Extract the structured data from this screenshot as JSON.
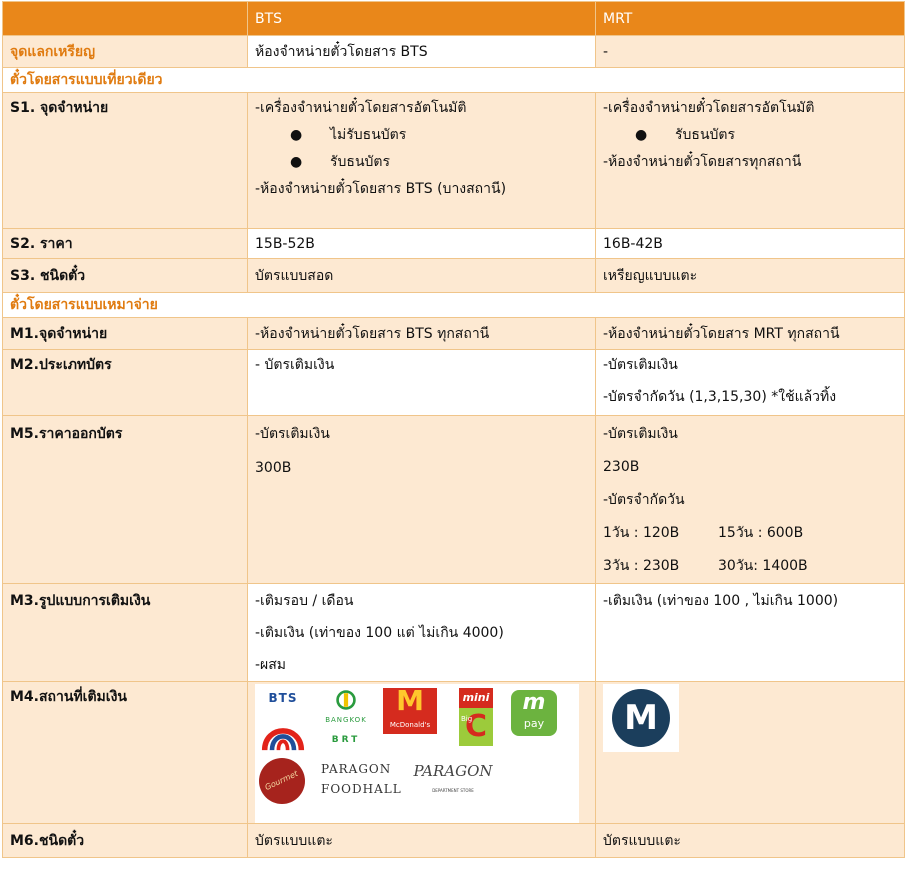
{
  "header": {
    "col1": "",
    "col2": "BTS",
    "col3": "MRT"
  },
  "coin_exchange": {
    "label": "จุดแลกเหรียญ",
    "bts": "ห้องจำหน่ายตั๋วโดยสาร BTS",
    "mrt": "-"
  },
  "section_single": {
    "title": "ตั๋วโดยสารแบบเที่ยวเดียว"
  },
  "s1": {
    "label": "S1. จุดจำหน่าย",
    "bts_line1": "-เครื่องจำหน่ายตั๋วโดยสารอัตโนมัติ",
    "bts_bullets": [
      "ไม่รับธนบัตร",
      "รับธนบัตร"
    ],
    "bts_line2": "-ห้องจำหน่ายตั๋วโดยสาร BTS (บางสถานี)",
    "mrt_line1": "-เครื่องจำหน่ายตั๋วโดยสารอัตโนมัติ",
    "mrt_bullets": [
      "รับธนบัตร"
    ],
    "mrt_line2": "-ห้องจำหน่ายตั๋วโดยสารทุกสถานี"
  },
  "s2": {
    "label": "S2. ราคา",
    "bts": "15B-52B",
    "mrt": "16B-42B"
  },
  "s3": {
    "label": "S3. ชนิดตั๋ว",
    "bts": "บัตรแบบสอด",
    "mrt": "เหรียญแบบแตะ"
  },
  "section_pass": {
    "title": "ตั๋วโดยสารแบบเหมาจ่าย"
  },
  "m1": {
    "label": "M1.จุดจำหน่าย",
    "bts": "-ห้องจำหน่ายตั๋วโดยสาร BTS ทุกสถานี",
    "mrt": "-ห้องจำหน่ายตั๋วโดยสาร MRT ทุกสถานี"
  },
  "m2": {
    "label": "M2.ประเภทบัตร",
    "bts": "- บัตรเติมเงิน",
    "mrt_line1": "-บัตรเติมเงิน",
    "mrt_line2": "-บัตรจำกัดวัน (1,3,15,30) *ใช้แล้วทิ้ง"
  },
  "m5": {
    "label": "M5.ราคาออกบัตร",
    "bts_line1": "-บัตรเติมเงิน",
    "bts_line2": "300B",
    "mrt_line1": "-บัตรเติมเงิน",
    "mrt_line2": "230B",
    "mrt_line3": "-บัตรจำกัดวัน",
    "mrt_r1a": "1วัน : 120B",
    "mrt_r1b": "15วัน : 600B",
    "mrt_r2a": "3วัน : 230B",
    "mrt_r2b": "30วัน: 1400B"
  },
  "m3": {
    "label": "M3.รูปแบบการเติมเงิน",
    "bts_line1": "-เติมรอบ / เดือน",
    "bts_line2": "-เติมเงิน (เท่าของ 100 แต่ ไม่เกิน 4000)",
    "bts_line3": "-ผสม",
    "mrt": "-เติมเงิน (เท่าของ 100 , ไม่เกิน 1000)"
  },
  "m4": {
    "label": "M4.สถานที่เติมเงิน",
    "logos": {
      "bts": "BTS",
      "brt_top": "BANGKOK",
      "brt_bottom": "BRT",
      "mcd": "McDonald's",
      "mini": "mini",
      "bigc": "Big",
      "mpay": "pay",
      "gourmet": "Gourmet",
      "paragon_food_1": "PARAGON",
      "paragon_food_2": "FOODHALL",
      "paragon_store": "PARAGON",
      "paragon_store_sub": "DEPARTMENT STORE",
      "mrt": "M"
    },
    "colors": {
      "bts_red": "#e2231a",
      "bts_blue": "#1f4e9a",
      "brt_green": "#2a9b3e",
      "mcd_red": "#d52b1e",
      "mcd_yellow": "#ffc72c",
      "mpay_green": "#6cb33f",
      "gourmet_red": "#a6231d",
      "mrt_navy": "#1b3e5c"
    }
  },
  "m6": {
    "label": "M6.ชนิดตั๋ว",
    "bts": "บัตรแบบแตะ",
    "mrt": "บัตรแบบแตะ"
  }
}
